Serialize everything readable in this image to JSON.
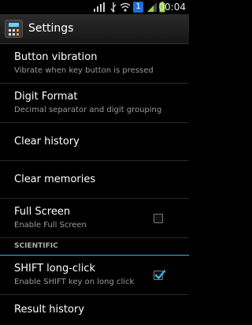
{
  "status_bar": {
    "time": "00:04",
    "icons": [
      "signal-bars-icon",
      "usb-debug-icon",
      "wifi-icon",
      "notification-1-icon",
      "cell-signal-icon",
      "battery-icon"
    ],
    "notification_count": "1",
    "accent": "#33b5e5"
  },
  "action_bar": {
    "title": "Settings",
    "icon": "calculator-icon"
  },
  "settings": [
    {
      "title": "Button vibration",
      "summary": "Vibrate when key button is pressed"
    },
    {
      "title": "Digit Format",
      "summary": "Decimal separator and digit grouping"
    },
    {
      "title": "Clear history"
    },
    {
      "title": "Clear memories"
    },
    {
      "title": "Full Screen",
      "summary": "Enable Full Screen",
      "checked": false
    }
  ],
  "section": {
    "label": "SCIENTIFIC"
  },
  "scientific": [
    {
      "title": "SHIFT long-click",
      "summary": "Enable SHIFT key on long click",
      "checked": true
    },
    {
      "title": "Result history"
    }
  ]
}
